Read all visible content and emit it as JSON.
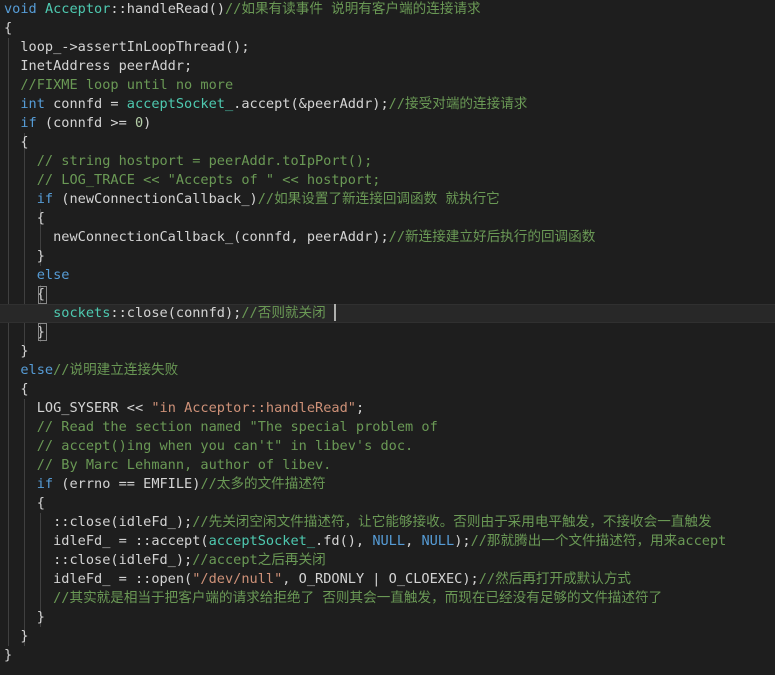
{
  "editor": {
    "colors": {
      "background": "#1e1e1e",
      "text": "#d4d4d4",
      "keyword": "#569cd6",
      "function": "#4ec9b0",
      "string": "#ce9178",
      "number": "#b5cea8",
      "comment": "#6a9955"
    },
    "lines": [
      [
        [
          "kw",
          "void"
        ],
        [
          "pl",
          " "
        ],
        [
          "fn",
          "Acceptor"
        ],
        [
          "pl",
          "::handleRead()"
        ],
        [
          "cm",
          "//如果有读事件 说明有客户端的连接请求"
        ]
      ],
      [
        [
          "pl",
          "{"
        ]
      ],
      [
        [
          "pl",
          "  loop_->assertInLoopThread();"
        ]
      ],
      [
        [
          "pl",
          "  InetAddress peerAddr;"
        ]
      ],
      [
        [
          "cm",
          "  //FIXME loop until no more"
        ]
      ],
      [
        [
          "kw",
          "  int"
        ],
        [
          "pl",
          " connfd = "
        ],
        [
          "fn",
          "acceptSocket_"
        ],
        [
          "pl",
          ".accept(&peerAddr);"
        ],
        [
          "cm",
          "//接受对端的连接请求"
        ]
      ],
      [
        [
          "kw",
          "  if"
        ],
        [
          "pl",
          " (connfd >= "
        ],
        [
          "num",
          "0"
        ],
        [
          "pl",
          ")"
        ]
      ],
      [
        [
          "pl",
          "  {"
        ]
      ],
      [
        [
          "cm",
          "    // string hostport = peerAddr.toIpPort();"
        ]
      ],
      [
        [
          "cm",
          "    // LOG_TRACE << \"Accepts of \" << hostport;"
        ]
      ],
      [
        [
          "kw",
          "    if"
        ],
        [
          "pl",
          " (newConnectionCallback_)"
        ],
        [
          "cm",
          "//如果设置了新连接回调函数 就执行它"
        ]
      ],
      [
        [
          "pl",
          "    {"
        ]
      ],
      [
        [
          "pl",
          "      newConnectionCallback_(connfd, peerAddr);"
        ],
        [
          "cm",
          "//新连接建立好后执行的回调函数"
        ]
      ],
      [
        [
          "pl",
          "    }"
        ]
      ],
      [
        [
          "kw",
          "    else"
        ]
      ],
      [
        [
          "pl",
          "    {"
        ]
      ],
      [
        [
          "fn",
          "      sockets"
        ],
        [
          "pl",
          "::close(connfd);"
        ],
        [
          "cm",
          "//否则就关闭"
        ]
      ],
      [
        [
          "pl",
          "    }"
        ]
      ],
      [
        [
          "pl",
          "  }"
        ]
      ],
      [
        [
          "kw",
          "  else"
        ],
        [
          "cm",
          "//说明建立连接失败"
        ]
      ],
      [
        [
          "pl",
          "  {"
        ]
      ],
      [
        [
          "pl",
          "    LOG_SYSERR << "
        ],
        [
          "str",
          "\"in Acceptor::handleRead\""
        ],
        [
          "pl",
          ";"
        ]
      ],
      [
        [
          "cm",
          "    // Read the section named \"The special problem of"
        ]
      ],
      [
        [
          "cm",
          "    // accept()ing when you can't\" in libev's doc."
        ]
      ],
      [
        [
          "cm",
          "    // By Marc Lehmann, author of libev."
        ]
      ],
      [
        [
          "kw",
          "    if"
        ],
        [
          "pl",
          " (errno == EMFILE)"
        ],
        [
          "cm",
          "//太多的文件描述符"
        ]
      ],
      [
        [
          "pl",
          "    {"
        ]
      ],
      [
        [
          "pl",
          "      ::close(idleFd_);"
        ],
        [
          "cm",
          "//先关闭空闲文件描述符，让它能够接收。否则由于采用电平触发，不接收会一直触发"
        ]
      ],
      [
        [
          "pl",
          "      idleFd_ = ::accept("
        ],
        [
          "fn",
          "acceptSocket_"
        ],
        [
          "pl",
          ".fd(), "
        ],
        [
          "kw",
          "NULL"
        ],
        [
          "pl",
          ", "
        ],
        [
          "kw",
          "NULL"
        ],
        [
          "pl",
          ");"
        ],
        [
          "cm",
          "//那就腾出一个文件描述符，用来accept"
        ]
      ],
      [
        [
          "pl",
          "      ::close(idleFd_);"
        ],
        [
          "cm",
          "//accept之后再关闭"
        ]
      ],
      [
        [
          "pl",
          "      idleFd_ = ::open("
        ],
        [
          "str",
          "\"/dev/null\""
        ],
        [
          "pl",
          ", O_RDONLY | O_CLOEXEC);"
        ],
        [
          "cm",
          "//然后再打开成默认方式"
        ]
      ],
      [
        [
          "cm",
          "      //其实就是相当于把客户端的请求给拒绝了 否则其会一直触发，而现在已经没有足够的文件描述符了"
        ]
      ],
      [
        [
          "pl",
          "    }"
        ]
      ],
      [
        [
          "pl",
          "  }"
        ]
      ],
      [
        [
          "pl",
          "}"
        ]
      ]
    ],
    "current_line_index": 16
  }
}
